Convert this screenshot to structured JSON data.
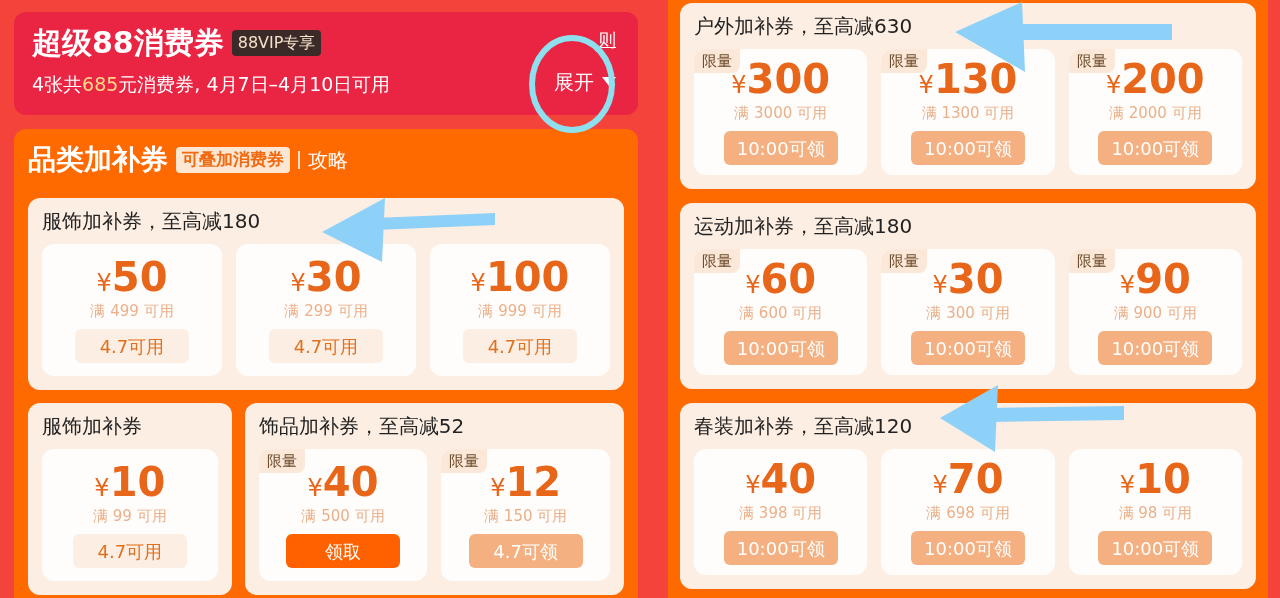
{
  "left": {
    "header": {
      "title": "超级88消费券",
      "badge": "88VIP专享",
      "subtitle": "4张共**685**元消费券, 4月7日–4月10日可用",
      "rules_link": "则",
      "expand_button": "展开"
    },
    "category": {
      "title": "品类加补券",
      "tag": "可叠加消费券",
      "link": "攻略"
    },
    "rows": [
      [
        {
          "title": "服饰加补券，至高减180",
          "coupons": [
            {
              "currency": "¥",
              "amount": "50",
              "condition": "满 499 可用",
              "action": {
                "kind": "used",
                "label": "4.7可用"
              }
            },
            {
              "currency": "¥",
              "amount": "30",
              "condition": "满 299 可用",
              "action": {
                "kind": "used",
                "label": "4.7可用"
              }
            },
            {
              "currency": "¥",
              "amount": "100",
              "condition": "满 999 可用",
              "action": {
                "kind": "used",
                "label": "4.7可用"
              }
            }
          ]
        }
      ],
      [
        {
          "title": "服饰加补券",
          "coupons": [
            {
              "currency": "¥",
              "amount": "10",
              "condition": "满 99 可用",
              "action": {
                "kind": "used",
                "label": "4.7可用"
              }
            }
          ]
        },
        {
          "title": "饰品加补券，至高减52",
          "coupons": [
            {
              "tag": "限量",
              "currency": "¥",
              "amount": "40",
              "condition": "满 500 可用",
              "action": {
                "kind": "claim",
                "label": "领取"
              }
            },
            {
              "tag": "限量",
              "currency": "¥",
              "amount": "12",
              "condition": "满 150 可用",
              "action": {
                "kind": "timed",
                "label": "4.7可领"
              }
            }
          ]
        }
      ]
    ]
  },
  "right": {
    "rows": [
      [
        {
          "title": "户外加补券，至高减630",
          "coupons": [
            {
              "tag": "限量",
              "currency": "¥",
              "amount": "300",
              "condition": "满 3000 可用",
              "action": {
                "kind": "timed",
                "label": "10:00可领"
              }
            },
            {
              "tag": "限量",
              "currency": "¥",
              "amount": "130",
              "condition": "满 1300 可用",
              "action": {
                "kind": "timed",
                "label": "10:00可领"
              }
            },
            {
              "tag": "限量",
              "currency": "¥",
              "amount": "200",
              "condition": "满 2000 可用",
              "action": {
                "kind": "timed",
                "label": "10:00可领"
              }
            }
          ]
        }
      ],
      [
        {
          "title": "运动加补券，至高减180",
          "coupons": [
            {
              "tag": "限量",
              "currency": "¥",
              "amount": "60",
              "condition": "满 600 可用",
              "action": {
                "kind": "timed",
                "label": "10:00可领"
              }
            },
            {
              "tag": "限量",
              "currency": "¥",
              "amount": "30",
              "condition": "满 300 可用",
              "action": {
                "kind": "timed",
                "label": "10:00可领"
              }
            },
            {
              "tag": "限量",
              "currency": "¥",
              "amount": "90",
              "condition": "满 900 可用",
              "action": {
                "kind": "timed",
                "label": "10:00可领"
              }
            }
          ]
        }
      ],
      [
        {
          "title": "春装加补券，至高减120",
          "coupons": [
            {
              "currency": "¥",
              "amount": "40",
              "condition": "满 398 可用",
              "action": {
                "kind": "timed",
                "label": "10:00可领"
              }
            },
            {
              "currency": "¥",
              "amount": "70",
              "condition": "满 698 可用",
              "action": {
                "kind": "timed",
                "label": "10:00可领"
              }
            },
            {
              "currency": "¥",
              "amount": "10",
              "condition": "满 98 可用",
              "action": {
                "kind": "timed",
                "label": "10:00可领"
              }
            }
          ]
        }
      ]
    ]
  }
}
